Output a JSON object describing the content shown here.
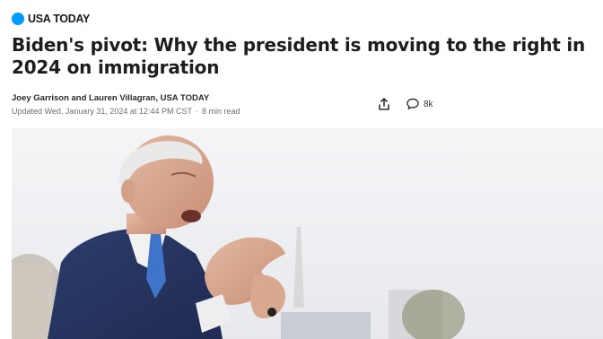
{
  "brand": {
    "name": "USA TODAY",
    "accent": "#009bff",
    "icon": "usa-today-dot-icon"
  },
  "article": {
    "headline": "Biden's pivot: Why the president is moving to the right in 2024 on immigration",
    "byline": "Joey Garrison and Lauren Villagran, USA TODAY",
    "updated": "Updated Wed, January 31, 2024 at 12:44 PM CST",
    "separator": "·",
    "read_time": "8 min read"
  },
  "actions": {
    "share_icon": "share-icon",
    "comments_icon": "comment-bubble-icon",
    "comments_count": "8k"
  },
  "photo": {
    "subject": "lead-photo"
  }
}
